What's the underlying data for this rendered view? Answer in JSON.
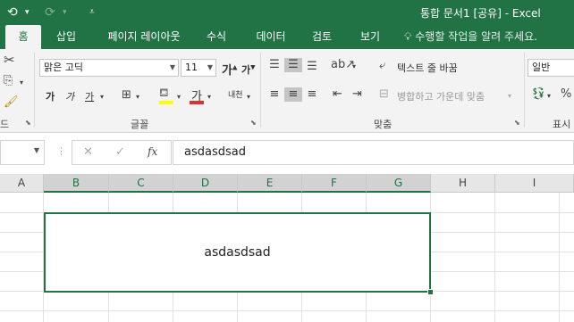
{
  "title": {
    "document": "통합 문서1",
    "shared": "[공유]",
    "separator": "-",
    "app": "Excel"
  },
  "qat": {
    "undo_icon": "undo-icon",
    "redo_icon": "redo-icon",
    "customize_icon": "customize-qat-icon"
  },
  "tabs": [
    {
      "label": "홈",
      "active": true
    },
    {
      "label": "삽입"
    },
    {
      "label": "페이지 레이아웃"
    },
    {
      "label": "수식"
    },
    {
      "label": "데이터"
    },
    {
      "label": "검토"
    },
    {
      "label": "보기"
    }
  ],
  "tellme": "수행할 작업을 알려 주세요.",
  "ribbon": {
    "font_name": "맑은 고딕",
    "font_size": "11",
    "bold": "가",
    "italic": "가",
    "underline": "가",
    "font_color_glyph": "가",
    "phonetic_glyph": "내천",
    "grow_font": "가",
    "shrink_font": "가",
    "font_group_label": "글꼴",
    "clipboard_group_label": "드",
    "align_group_label": "맞춤",
    "wrap_text": "텍스트 줄 바꿈",
    "merge_center": "병합하고 가운데 맞춤",
    "number_format": "일반",
    "number_group_label": "표시"
  },
  "formula_bar": {
    "cancel_glyph": "✕",
    "enter_glyph": "✓",
    "fx_glyph": "fx",
    "content": "asdasdsad"
  },
  "columns": [
    "A",
    "B",
    "C",
    "D",
    "E",
    "F",
    "G",
    "H",
    "I"
  ],
  "selected_columns": [
    "B",
    "C",
    "D",
    "E",
    "F",
    "G"
  ],
  "cell": {
    "merged_value": "asdasdsad"
  },
  "colors": {
    "accent": "#217346",
    "ribbon_bg": "#f3f3f3",
    "header_bg": "#e6e6e6",
    "font_color_bar": "#e03030",
    "highlight_bar": "#ffff00"
  }
}
